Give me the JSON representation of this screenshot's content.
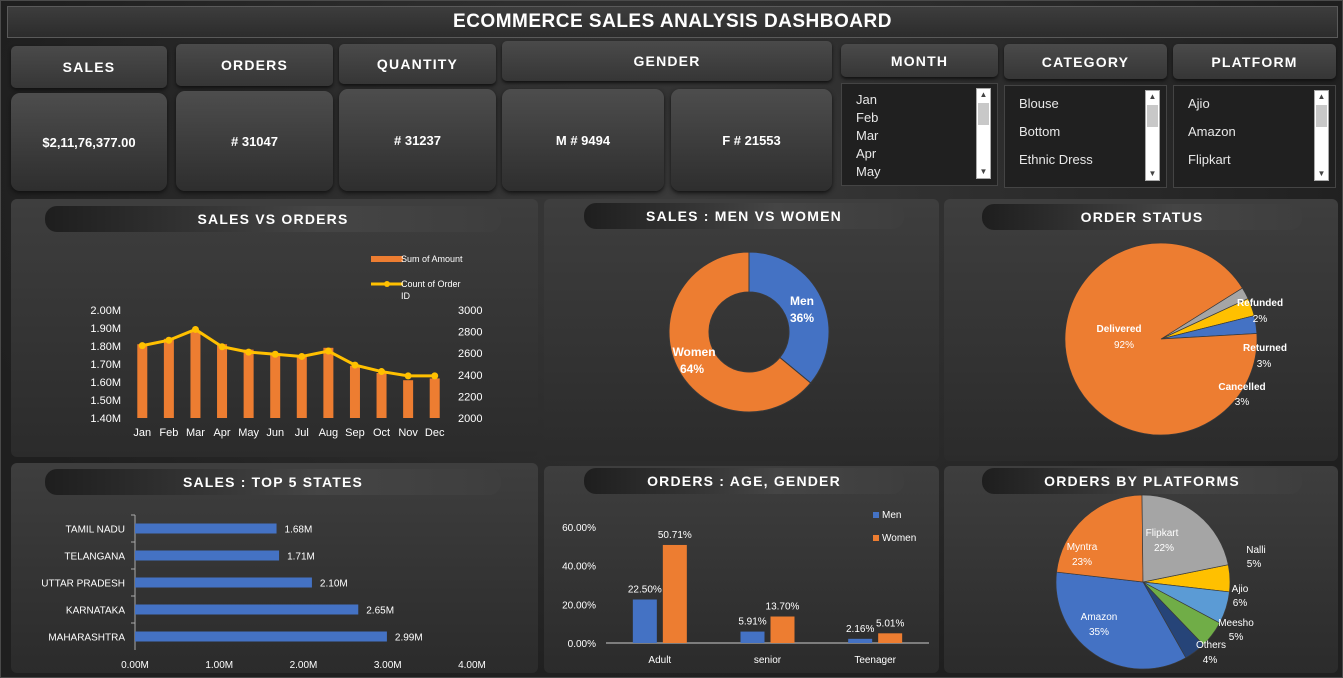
{
  "title": "ECOMMERCE SALES ANALYSIS DASHBOARD",
  "kpis": {
    "sales": {
      "label": "SALES",
      "value": "$2,11,76,377.00"
    },
    "orders": {
      "label": "ORDERS",
      "value": "# 31047"
    },
    "quantity": {
      "label": "QUANTITY",
      "value": "# 31237"
    },
    "gender": {
      "label": "GENDER",
      "male": "M # 9494",
      "female": "F # 21553"
    }
  },
  "slicers": {
    "month": {
      "label": "MONTH",
      "items": [
        "Jan",
        "Feb",
        "Mar",
        "Apr",
        "May"
      ]
    },
    "category": {
      "label": "CATEGORY",
      "items": [
        "Blouse",
        "Bottom",
        "Ethnic Dress"
      ]
    },
    "platform": {
      "label": "PLATFORM",
      "items": [
        "Ajio",
        "Amazon",
        "Flipkart"
      ]
    }
  },
  "panels": {
    "sales_vs_orders": "SALES VS ORDERS",
    "men_vs_women": "SALES : MEN VS WOMEN",
    "order_status": "ORDER STATUS",
    "top_states": "SALES : TOP 5 STATES",
    "age_gender": "ORDERS : AGE, GENDER",
    "platforms": "ORDERS BY PLATFORMS"
  },
  "colors": {
    "orange": "#ED7D31",
    "blue": "#4472C4",
    "yellow": "#FFC000",
    "gray": "#A5A5A5",
    "green": "#70AD47",
    "sky": "#5B9BD5",
    "navy": "#264478"
  },
  "chart_data": [
    {
      "type": "bar",
      "title": "SALES VS ORDERS",
      "categories": [
        "Jan",
        "Feb",
        "Mar",
        "Apr",
        "May",
        "Jun",
        "Jul",
        "Aug",
        "Sep",
        "Oct",
        "Nov",
        "Dec"
      ],
      "series": [
        {
          "name": "Sum of Amount",
          "type": "bar",
          "axis": "left",
          "values": [
            1.81,
            1.84,
            1.88,
            1.81,
            1.78,
            1.76,
            1.75,
            1.79,
            1.69,
            1.65,
            1.61,
            1.62
          ]
        },
        {
          "name": "Count of Order ID",
          "type": "line",
          "axis": "right",
          "values": [
            2670,
            2720,
            2820,
            2660,
            2610,
            2590,
            2570,
            2620,
            2490,
            2430,
            2390,
            2390
          ]
        }
      ],
      "ylim": [
        1.4,
        2.0
      ],
      "y2lim": [
        2000,
        3000
      ],
      "yticks": [
        "1.40M",
        "1.50M",
        "1.60M",
        "1.70M",
        "1.80M",
        "1.90M",
        "2.00M"
      ],
      "y2ticks": [
        "2000",
        "2200",
        "2400",
        "2600",
        "2800",
        "3000"
      ],
      "legend_position": "top-right"
    },
    {
      "type": "pie",
      "title": "SALES : MEN VS WOMEN",
      "donut": true,
      "labels": [
        "Men",
        "Women"
      ],
      "values": [
        36,
        64
      ],
      "display": [
        "36%",
        "64%"
      ]
    },
    {
      "type": "pie",
      "title": "ORDER STATUS",
      "labels": [
        "Delivered",
        "Refunded",
        "Returned",
        "Cancelled"
      ],
      "values": [
        92,
        2,
        3,
        3
      ],
      "display": [
        "92%",
        "2%",
        "3%",
        "3%"
      ]
    },
    {
      "type": "bar",
      "orientation": "horizontal",
      "title": "SALES : TOP 5 STATES",
      "categories": [
        "TAMIL NADU",
        "TELANGANA",
        "UTTAR PRADESH",
        "KARNATAKA",
        "MAHARASHTRA"
      ],
      "values": [
        1.68,
        1.71,
        2.1,
        2.65,
        2.99
      ],
      "labels": [
        "1.68M",
        "1.71M",
        "2.10M",
        "2.65M",
        "2.99M"
      ],
      "xlim": [
        0,
        4
      ],
      "xticks": [
        "0.00M",
        "1.00M",
        "2.00M",
        "3.00M",
        "4.00M"
      ]
    },
    {
      "type": "bar",
      "title": "ORDERS : AGE, GENDER",
      "categories": [
        "Adult",
        "senior",
        "Teenager"
      ],
      "series": [
        {
          "name": "Men",
          "values": [
            22.5,
            5.91,
            2.16
          ],
          "labels": [
            "22.50%",
            "5.91%",
            "2.16%"
          ]
        },
        {
          "name": "Women",
          "values": [
            50.71,
            13.7,
            5.01
          ],
          "labels": [
            "50.71%",
            "13.70%",
            "5.01%"
          ]
        }
      ],
      "ylim": [
        0,
        60
      ],
      "yticks": [
        "0.00%",
        "20.00%",
        "40.00%",
        "60.00%"
      ],
      "legend_position": "top-right"
    },
    {
      "type": "pie",
      "title": "ORDERS BY PLATFORMS",
      "labels": [
        "Amazon",
        "Myntra",
        "Flipkart",
        "Nalli",
        "Ajio",
        "Meesho",
        "Others"
      ],
      "values": [
        35,
        23,
        22,
        5,
        6,
        5,
        4
      ],
      "display": [
        "35%",
        "23%",
        "22%",
        "5%",
        "6%",
        "5%",
        "4%"
      ]
    }
  ]
}
